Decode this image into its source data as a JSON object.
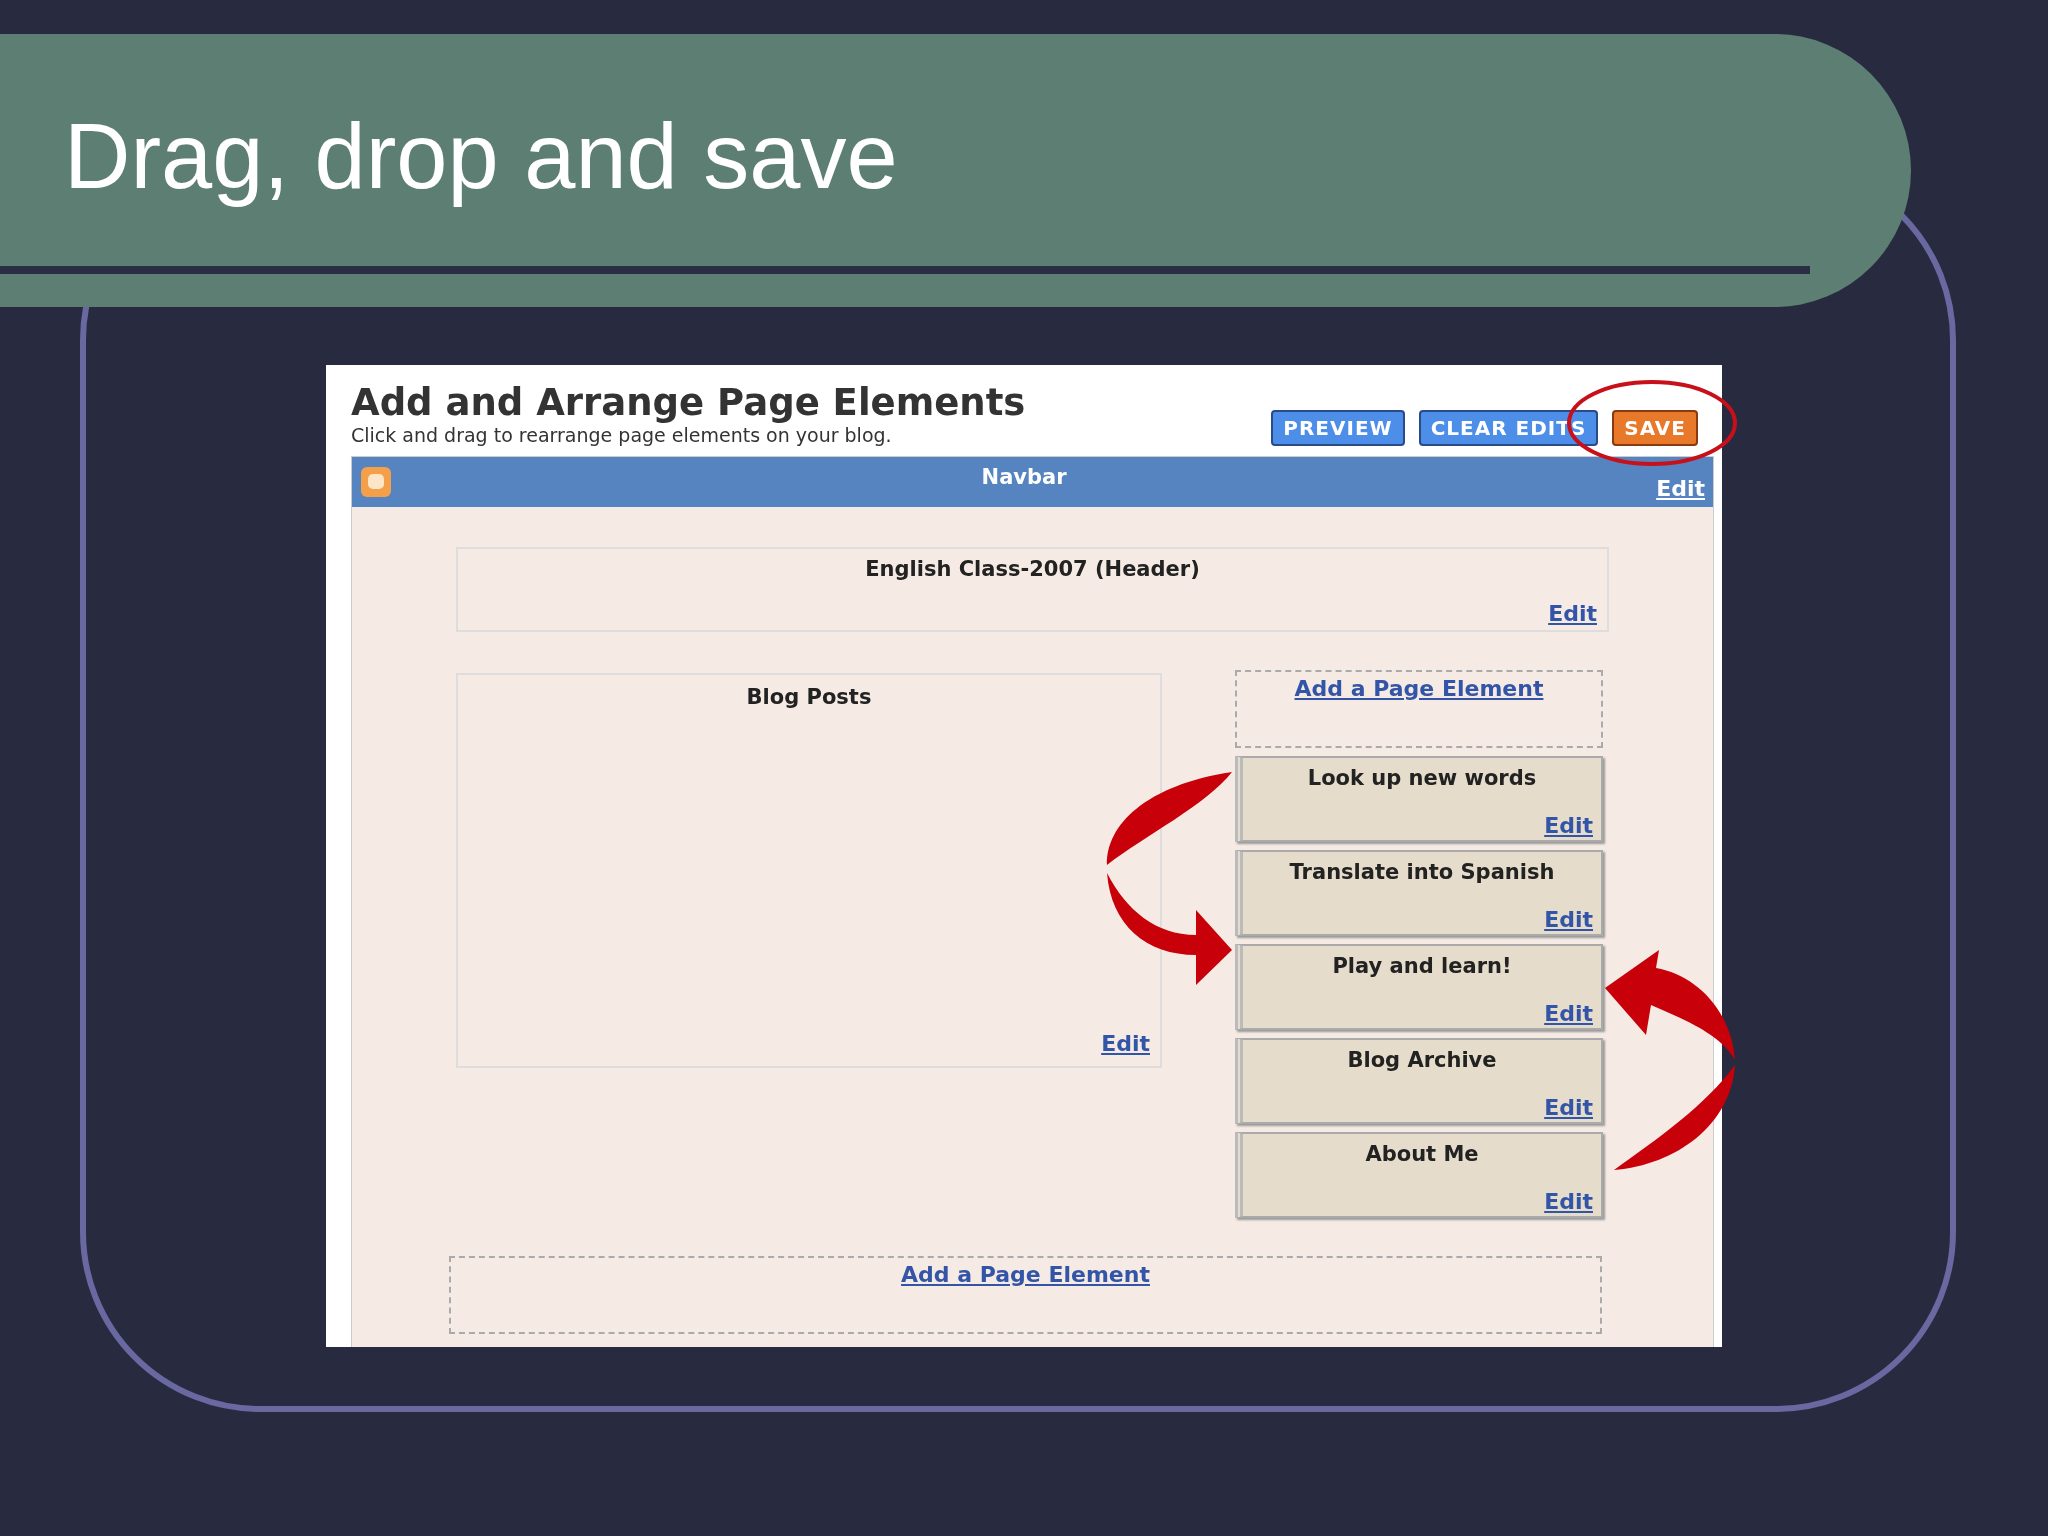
{
  "slide_title": "Drag, drop and save",
  "screen": {
    "heading": "Add and Arrange Page Elements",
    "subtitle": "Click and drag to rearrange page elements on your blog.",
    "buttons": [
      {
        "label": "PREVIEW",
        "kind": "blue",
        "highlighted": false
      },
      {
        "label": "CLEAR EDITS",
        "kind": "blue",
        "highlighted": false
      },
      {
        "label": "SAVE",
        "kind": "orange",
        "highlighted": true
      }
    ],
    "navbar": {
      "title": "Navbar",
      "edit": "Edit"
    },
    "header_element": {
      "title": "English Class-2007 (Header)",
      "edit": "Edit"
    },
    "main_element": {
      "title": "Blog Posts",
      "edit": "Edit"
    },
    "sidebar": {
      "add_link": "Add a Page Element",
      "gadgets": [
        {
          "title": "Look up new words",
          "edit": "Edit"
        },
        {
          "title": "Translate into Spanish",
          "edit": "Edit"
        },
        {
          "title": "Play and learn!",
          "edit": "Edit"
        },
        {
          "title": "Blog Archive",
          "edit": "Edit"
        },
        {
          "title": "About Me",
          "edit": "Edit"
        }
      ]
    },
    "footer_add_link": "Add a Page Element"
  }
}
